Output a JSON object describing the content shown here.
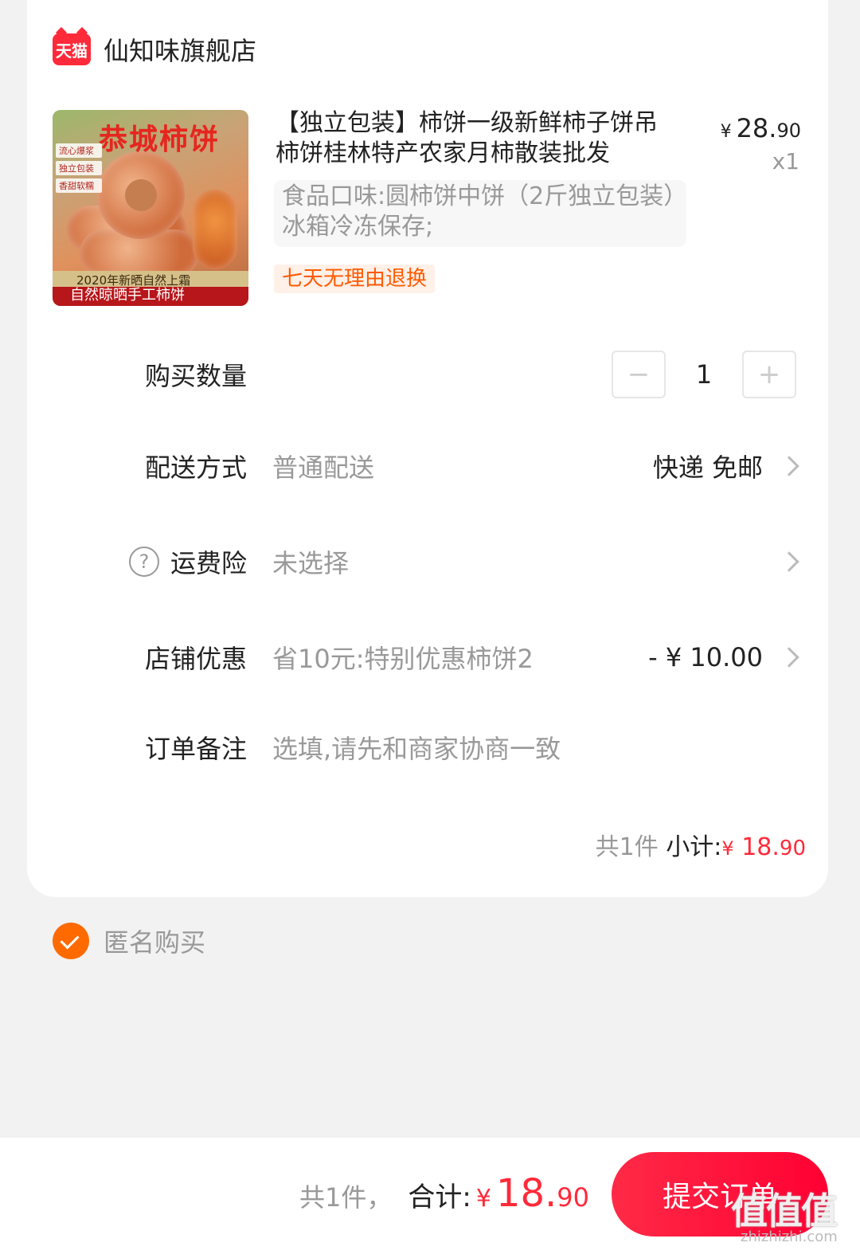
{
  "shop": {
    "badge": "天猫",
    "name": "仙知味旗舰店"
  },
  "product": {
    "title": "【独立包装】柿饼一级新鲜柿子饼吊柿饼桂林特产农家月柿散装批发",
    "price_symbol": "¥",
    "price_int": "28.",
    "price_cents": "90",
    "quantity_text": "x1",
    "sku": "食品口味:圆柿饼中饼（2斤独立包装）冰箱冷冻保存;",
    "tag": "七天无理由退换",
    "image": {
      "title": "恭城柿饼",
      "tags": [
        "流心爆浆",
        "独立包装",
        "香甜软糯"
      ],
      "banner_top": "2020年新晒自然上霜",
      "banner_bottom": "自然晾晒手工柿饼"
    }
  },
  "rows": {
    "quantity": {
      "label": "购买数量",
      "minus": "−",
      "value": "1",
      "plus": "+"
    },
    "delivery": {
      "label": "配送方式",
      "value": "普通配送",
      "right": "快递 免邮"
    },
    "insurance": {
      "label": "运费险",
      "help": "?",
      "value": "未选择"
    },
    "discount": {
      "label": "店铺优惠",
      "value": "省10元:特别优惠柿饼2",
      "right": "- ¥ 10.00"
    },
    "note": {
      "label": "订单备注",
      "placeholder": "选填,请先和商家协商一致"
    }
  },
  "subtotal": {
    "count": "共1件",
    "label": "小计:",
    "symbol": "¥",
    "int": "18.",
    "cents": "90"
  },
  "anonymous": {
    "label": "匿名购买",
    "checked": true
  },
  "footer": {
    "count": "共1件，",
    "label": "合计:",
    "symbol": "¥",
    "int": "18.",
    "cents": "90",
    "submit": "提交订单"
  },
  "watermark": {
    "main": "值值值",
    "sub": "zhizhizhi.com"
  },
  "colors": {
    "accent": "#ff2a3a",
    "orange": "#ff6a00",
    "background": "#f2f2f2"
  }
}
